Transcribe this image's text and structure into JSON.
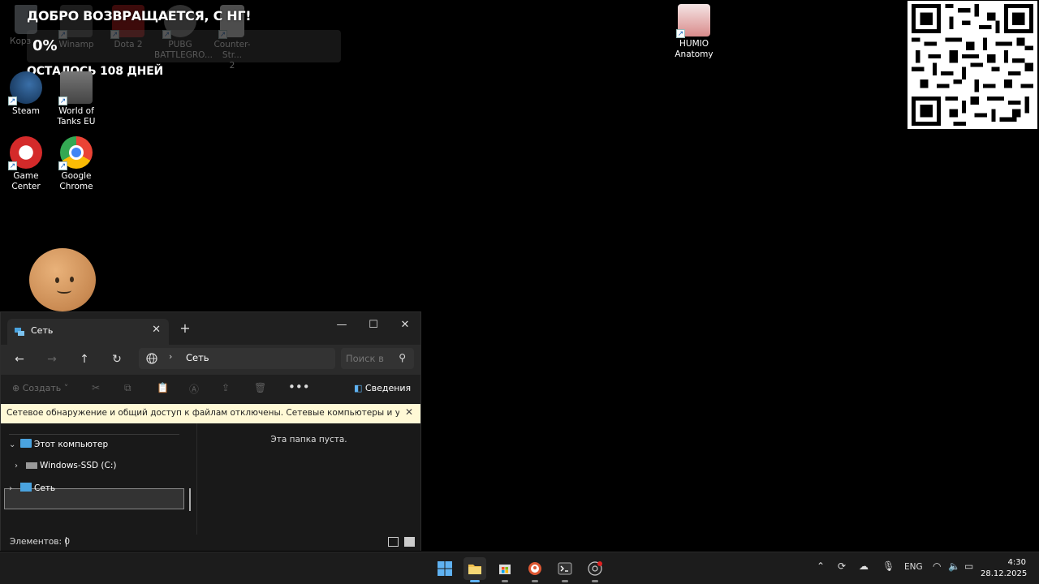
{
  "desktop": {
    "widget": {
      "title": "ДОБРО ВОЗВРАЩАЕТСЯ, С НГ!",
      "percent": "0%",
      "days_left": "ОСТАЛОСЬ 108 ДНЕЙ"
    },
    "icons": {
      "recycle": "Корз",
      "winamp": "Winamp",
      "dota2": "Dota 2",
      "pubg_line1": "PUBG",
      "pubg_line2": "BATTLEGRO...",
      "cs2_line1": "Counter-Str...",
      "cs2_line2": "2",
      "steam": "Steam",
      "wot_line1": "World of",
      "wot_line2": "Tanks EU",
      "gamecenter": "Game Center",
      "chrome_line1": "Google",
      "chrome_line2": "Chrome",
      "humio_line1": "HUMIO",
      "humio_line2": "Anatomy"
    }
  },
  "explorer": {
    "tab_title": "Сеть",
    "address": "Сеть",
    "search_placeholder": "Поиск в",
    "toolbar": {
      "create_label": "Создать",
      "details_label": "Сведения"
    },
    "banner": "Сетевое обнаружение и общий доступ к файлам отключены. Сетевые компьютеры и устройства не ви...",
    "nav": {
      "this_pc": "Этот компьютер",
      "drive_c": "Windows-SSD (C:)",
      "network": "Сеть"
    },
    "empty_message": "Эта папка пуста.",
    "status": "Элементов: 0"
  },
  "taskbar": {
    "language": "ENG",
    "time": "4:30",
    "date": "28.12.2025"
  },
  "colors": {
    "accent": "#5fb2f2",
    "banner_bg": "#fff9d6",
    "window_bg": "#191919"
  }
}
